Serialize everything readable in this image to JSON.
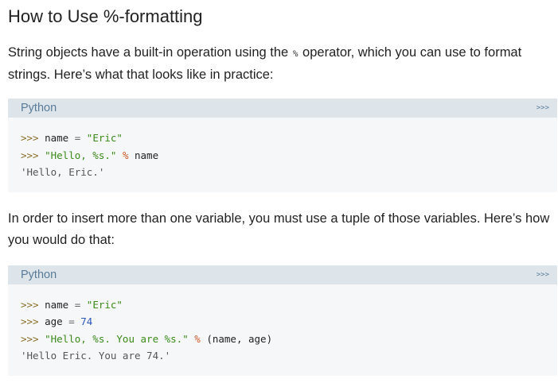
{
  "heading": "How to Use %-formatting",
  "para1": {
    "before": "String objects have a built-in operation using the",
    "code": "%",
    "after": "operator, which you can use to format strings. Here’s what that looks like in practice:"
  },
  "block1": {
    "language": "Python",
    "toggle": ">>>",
    "lines": [
      {
        "prompt": ">>>",
        "a": " name ",
        "op": "=",
        "val": " \"Eric\""
      },
      {
        "prompt": ">>>",
        "str": " \"Hello, %s.\"",
        "pct": " %",
        "rest": " name"
      },
      {
        "output": "'Hello, Eric.'"
      }
    ]
  },
  "para2": "In order to insert more than one variable, you must use a tuple of those variables. Here’s how you would do that:",
  "block2": {
    "language": "Python",
    "toggle": ">>>",
    "lines": [
      {
        "prompt": ">>>",
        "a": " name ",
        "op": "=",
        "val": " \"Eric\""
      },
      {
        "prompt": ">>>",
        "a": " age ",
        "op": "=",
        "val": " 74"
      },
      {
        "prompt": ">>>",
        "str": " \"Hello, %s. You are %s.\"",
        "pct": " %",
        "rest": " (name, age)"
      },
      {
        "output": "'Hello Eric. You are 74.'"
      }
    ]
  }
}
